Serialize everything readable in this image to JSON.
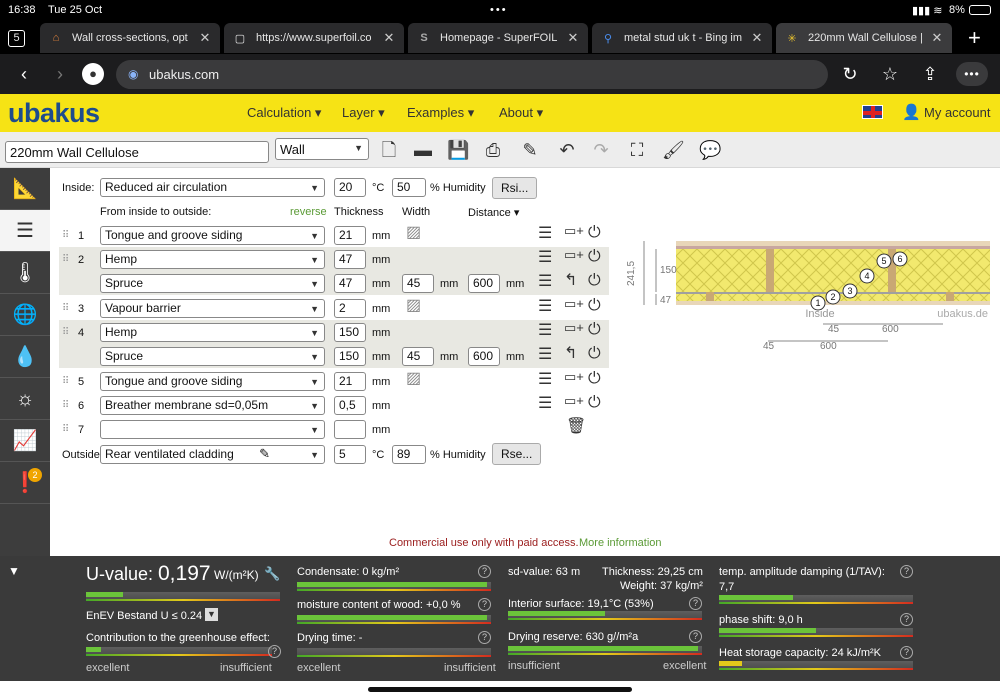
{
  "status": {
    "time": "16:38",
    "date": "Tue 25 Oct",
    "battery": "8%"
  },
  "tabs": [
    {
      "count": "5"
    },
    {
      "title": "Wall cross-sections, opt"
    },
    {
      "title": "https://www.superfoil.co"
    },
    {
      "title": "Homepage - SuperFOIL"
    },
    {
      "title": "metal stud uk t - Bing im"
    },
    {
      "title": "220mm Wall Cellulose |"
    }
  ],
  "url": "ubakus.com",
  "app": {
    "logo": "ubakus",
    "menu": [
      "Calculation ▾",
      "Layer ▾",
      "Examples ▾",
      "About ▾"
    ],
    "account": "My account"
  },
  "toolbar": {
    "name_value": "220mm Wall Cellulose",
    "type_value": "Wall"
  },
  "inside": {
    "label": "Inside:",
    "value": "Reduced air circulation",
    "temp": "20",
    "temp_unit": "°C",
    "humidity": "50",
    "humidity_unit": "% Humidity",
    "button": "Rsi..."
  },
  "headers": {
    "from": "From inside to outside:",
    "reverse": "reverse",
    "thickness": "Thickness",
    "width": "Width",
    "distance": "Distance ▾"
  },
  "layers": [
    {
      "num": "1",
      "material": "Tongue and groove siding",
      "thickness": "21",
      "unit": "mm"
    },
    {
      "num": "2",
      "material": "Hemp",
      "thickness": "47",
      "unit": "mm"
    },
    {
      "num": "",
      "material": "Spruce",
      "thickness": "47",
      "unit": "mm",
      "width": "45",
      "width_unit": "mm",
      "distance": "600",
      "distance_unit": "mm"
    },
    {
      "num": "3",
      "material": "Vapour barrier",
      "thickness": "2",
      "unit": "mm"
    },
    {
      "num": "4",
      "material": "Hemp",
      "thickness": "150",
      "unit": "mm"
    },
    {
      "num": "",
      "material": "Spruce",
      "thickness": "150",
      "unit": "mm",
      "width": "45",
      "width_unit": "mm",
      "distance": "600",
      "distance_unit": "mm"
    },
    {
      "num": "5",
      "material": "Tongue and groove siding",
      "thickness": "21",
      "unit": "mm"
    },
    {
      "num": "6",
      "material": "Breather membrane sd=0,05m",
      "thickness": "0,5",
      "unit": "mm"
    },
    {
      "num": "7",
      "material": "",
      "thickness": "",
      "unit": "mm"
    }
  ],
  "outside": {
    "label": "Outside",
    "value": "Rear ventilated cladding",
    "temp": "5",
    "temp_unit": "°C",
    "humidity": "89",
    "humidity_unit": "% Humidity",
    "button": "Rse..."
  },
  "diagram": {
    "dim_total": "241,5",
    "dim_150": "150",
    "dim_47": "47",
    "inside": "Inside",
    "watermark": "ubakus.de",
    "d45a": "45",
    "d600a": "600",
    "d45b": "45",
    "d600b": "600",
    "circles": [
      "1",
      "2",
      "3",
      "4",
      "5",
      "6"
    ]
  },
  "footer": {
    "commercial": "Commercial use only with paid access.",
    "more": "More information"
  },
  "results": {
    "uvalue_label": "U-value:",
    "uvalue": "0,197",
    "uvalue_unit": "W/(m²K)",
    "enev": "EnEV Bestand U ≤ 0.24",
    "greenhouse": "Contribution to the greenhouse effect:",
    "excellent": "excellent",
    "insufficient": "insufficient",
    "condensate": "Condensate: 0 kg/m²",
    "moisture": "moisture content of wood: +0,0 %",
    "drying_time": "Drying time: -",
    "sd": "sd-value: 63 m",
    "thickness": "Thickness: 29,25 cm",
    "weight": "Weight: 37 kg/m²",
    "interior": "Interior surface: 19,1°C (53%)",
    "drying_reserve": "Drying reserve: 630 g//m²a",
    "temp_amp": "temp. amplitude damping (1/TAV):",
    "temp_amp_value": "7,7",
    "phase": "phase shift: 9,0 h",
    "heat": "Heat storage capacity: 24 kJ/m²K",
    "fills": {
      "uvalue": 0.19,
      "greenhouse": 0.08,
      "condensate": 0.98,
      "moisture": 0.98,
      "interior": 0.5,
      "drying": 0.98,
      "temp_amp": 0.38,
      "phase": 0.5,
      "heat": 0.12
    },
    "colors": {
      "good": "#6bc43a",
      "medium": "#e3c91a",
      "bad": "#d42b1f"
    }
  },
  "sidebar_badge": "2"
}
